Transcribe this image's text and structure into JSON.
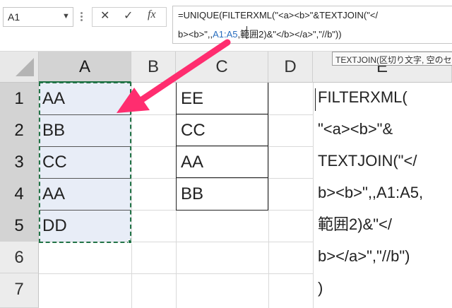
{
  "name_box": {
    "value": "A1",
    "dropdown_icon": "chevron-down-icon"
  },
  "formula_buttons": {
    "cancel": "✕",
    "enter": "✓",
    "function": "fx"
  },
  "formula_bar": {
    "line1": "=UNIQUE(FILTERXML(\"<a><b>\"&TEXTJOIN(\"</",
    "line2_a": "b><b>\",,",
    "line2_ref": "A1:A5",
    "line2_b": ",範囲2)&\"</b></a>\",\"//b\"))"
  },
  "tooltip": "TEXTJOIN(区切り文字, 空のセルは",
  "columns": [
    "A",
    "B",
    "C",
    "D",
    "E"
  ],
  "rows": [
    "1",
    "2",
    "3",
    "4",
    "5",
    "6",
    "7"
  ],
  "column_a": [
    "AA",
    "BB",
    "CC",
    "AA",
    "DD"
  ],
  "column_c": [
    "EE",
    "CC",
    "AA",
    "BB"
  ],
  "cell_e_lines": [
    "FILTERXML(",
    "\"<a><b>\"&",
    "TEXTJOIN(\"</",
    "b><b>\",,A1:A5,",
    "範囲2)&\"</",
    "b></a>\",\"//b\")",
    ")"
  ],
  "colors": {
    "selection_border": "#217346",
    "arrow": "#ff2d6f",
    "reference": "#2a6fbf"
  }
}
